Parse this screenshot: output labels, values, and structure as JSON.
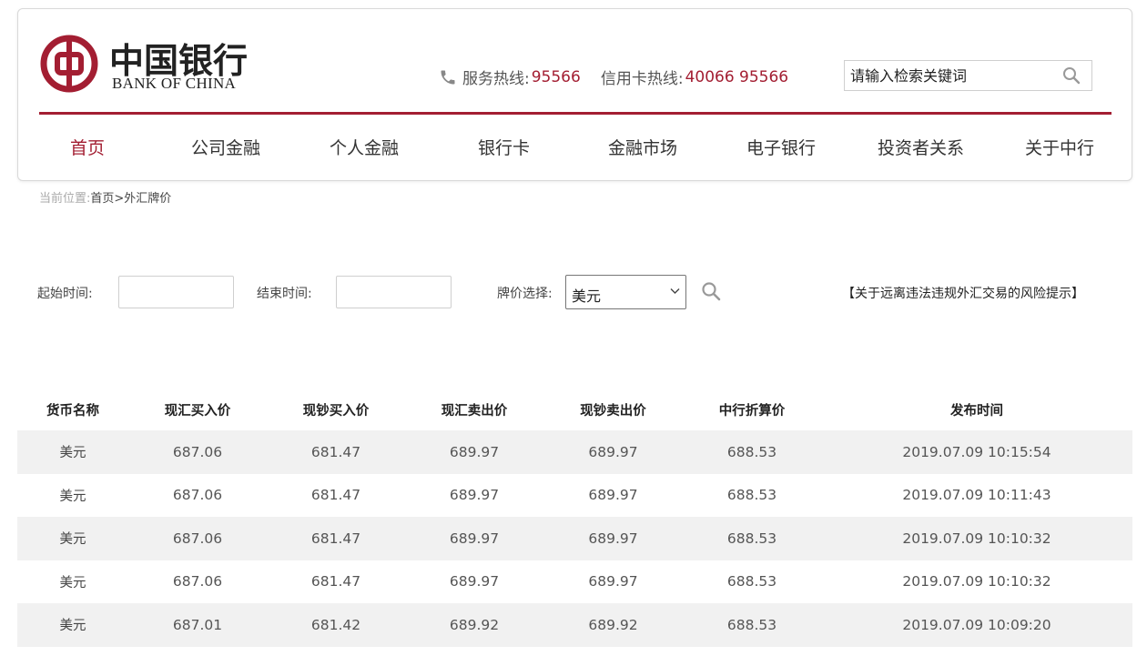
{
  "header": {
    "logo": {
      "cn": "中国银行",
      "en": "BANK OF CHINA"
    },
    "hotline_label": "服务热线:",
    "hotline_number": "95566",
    "card_hotline_label": "信用卡热线:",
    "card_hotline_number": "40066 95566",
    "search_placeholder": "请输入检索关键词",
    "brand_color": "#a31e32"
  },
  "nav": {
    "items": [
      {
        "label": "首页",
        "active": true
      },
      {
        "label": "公司金融"
      },
      {
        "label": "个人金融"
      },
      {
        "label": "银行卡"
      },
      {
        "label": "金融市场"
      },
      {
        "label": "电子银行"
      },
      {
        "label": "投资者关系"
      },
      {
        "label": "关于中行"
      }
    ]
  },
  "breadcrumb": {
    "label": "当前位置:",
    "path": "首页>外汇牌价"
  },
  "filters": {
    "start_label": "起始时间:",
    "start_value": "",
    "end_label": "结束时间:",
    "end_value": "",
    "currency_label": "牌价选择:",
    "currency_value": "美元",
    "risk_link": "【关于远离违法违规外汇交易的风险提示】"
  },
  "table": {
    "headers": [
      "货币名称",
      "现汇买入价",
      "现钞买入价",
      "现汇卖出价",
      "现钞卖出价",
      "中行折算价",
      "发布时间"
    ],
    "rows": [
      [
        "美元",
        "687.06",
        "681.47",
        "689.97",
        "689.97",
        "688.53",
        "2019.07.09 10:15:54"
      ],
      [
        "美元",
        "687.06",
        "681.47",
        "689.97",
        "689.97",
        "688.53",
        "2019.07.09 10:11:43"
      ],
      [
        "美元",
        "687.06",
        "681.47",
        "689.97",
        "689.97",
        "688.53",
        "2019.07.09 10:10:32"
      ],
      [
        "美元",
        "687.06",
        "681.47",
        "689.97",
        "689.97",
        "688.53",
        "2019.07.09 10:10:32"
      ],
      [
        "美元",
        "687.01",
        "681.42",
        "689.92",
        "689.92",
        "688.53",
        "2019.07.09 10:09:20"
      ]
    ]
  }
}
